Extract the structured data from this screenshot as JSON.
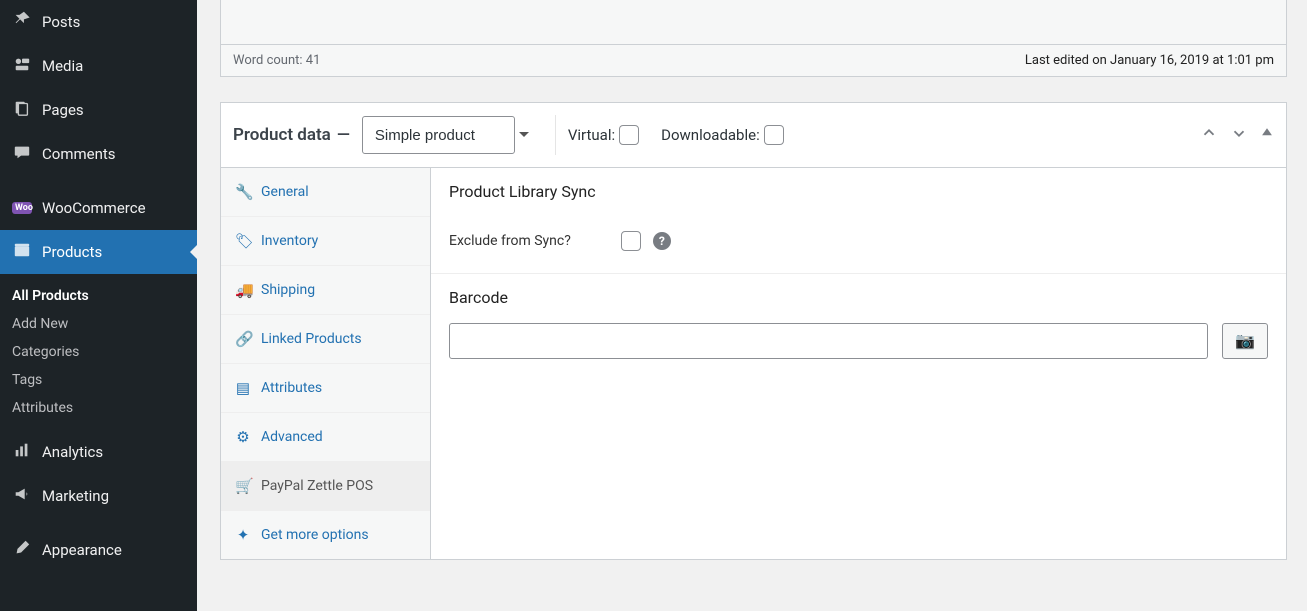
{
  "sidebar": {
    "menu": [
      {
        "icon": "pin",
        "label": "Posts"
      },
      {
        "icon": "media",
        "label": "Media"
      },
      {
        "icon": "pages",
        "label": "Pages"
      },
      {
        "icon": "comment",
        "label": "Comments"
      },
      {
        "icon": "woo",
        "label": "WooCommerce"
      },
      {
        "icon": "products",
        "label": "Products"
      },
      {
        "icon": "analytics",
        "label": "Analytics"
      },
      {
        "icon": "marketing",
        "label": "Marketing"
      },
      {
        "icon": "appearance",
        "label": "Appearance"
      }
    ],
    "products_submenu": [
      {
        "label": "All Products",
        "current": true
      },
      {
        "label": "Add New"
      },
      {
        "label": "Categories"
      },
      {
        "label": "Tags"
      },
      {
        "label": "Attributes"
      }
    ]
  },
  "editor_status": {
    "word_count_label": "Word count: 41",
    "last_edit": "Last edited on January 16, 2019 at 1:01 pm"
  },
  "product_data": {
    "title": "Product data",
    "type_selected": "Simple product",
    "virtual_label": "Virtual:",
    "downloadable_label": "Downloadable:",
    "tabs": [
      {
        "key": "general",
        "label": "General",
        "icon": "wrench"
      },
      {
        "key": "inventory",
        "label": "Inventory",
        "icon": "tag"
      },
      {
        "key": "shipping",
        "label": "Shipping",
        "icon": "truck"
      },
      {
        "key": "linked",
        "label": "Linked Products",
        "icon": "link"
      },
      {
        "key": "attrs",
        "label": "Attributes",
        "icon": "list"
      },
      {
        "key": "advanced",
        "label": "Advanced",
        "icon": "gear"
      },
      {
        "key": "zettle",
        "label": "PayPal Zettle POS",
        "icon": "cart",
        "active": true
      },
      {
        "key": "more",
        "label": "Get more options",
        "icon": "plugin"
      }
    ],
    "panel": {
      "sync_title": "Product Library Sync",
      "exclude_label": "Exclude from Sync?",
      "barcode_title": "Barcode",
      "barcode_value": ""
    }
  }
}
